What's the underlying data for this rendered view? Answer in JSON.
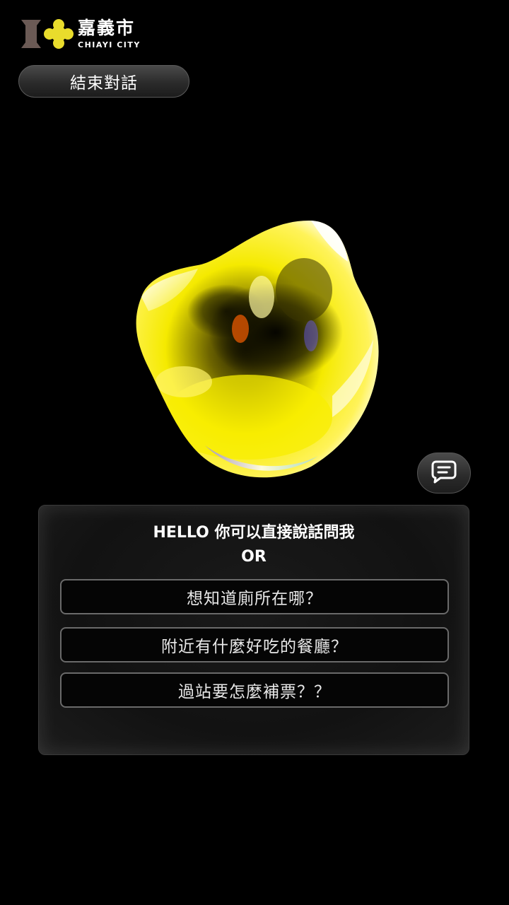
{
  "logo": {
    "name_cn": "嘉義市",
    "name_en": "CHIAYI CITY"
  },
  "header": {
    "end_button_label": "結束對話"
  },
  "chat_button": {
    "icon": "message-icon"
  },
  "panel": {
    "title": "HELLO 你可以直接說話問我",
    "or_label": "OR",
    "suggestions": [
      {
        "label": "想知道廁所在哪？"
      },
      {
        "label": "附近有什麼好吃的餐廳？"
      },
      {
        "label": "過站要怎麼補票？？"
      }
    ]
  },
  "colors": {
    "background": "#000000",
    "accent_yellow": "#f2e400",
    "logo_brown": "#6b5a55"
  }
}
